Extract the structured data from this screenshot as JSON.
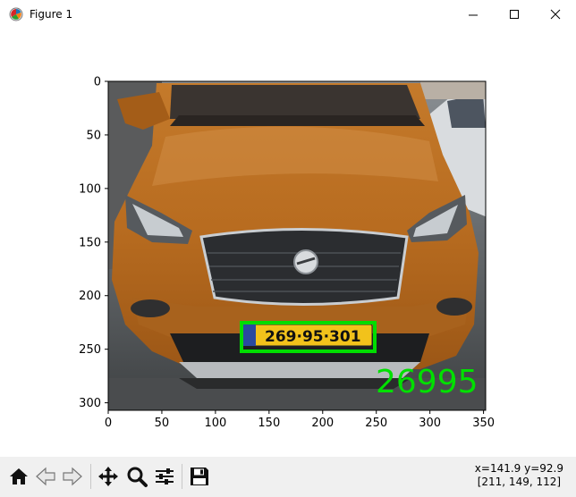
{
  "window": {
    "title": "Figure 1",
    "controls": [
      "minimize",
      "maximize",
      "close"
    ]
  },
  "plot": {
    "xticks": [
      "0",
      "50",
      "100",
      "150",
      "200",
      "250",
      "300",
      "350"
    ],
    "yticks": [
      "0",
      "50",
      "100",
      "150",
      "200",
      "250",
      "300"
    ],
    "xlim": [
      0,
      352
    ],
    "ylim": [
      0,
      307
    ],
    "image": {
      "description_type": "photo",
      "car_color": "#b5691f"
    },
    "detection_box": {
      "x1": 125,
      "y1": 225,
      "x2": 250,
      "y2": 253,
      "color": "#00dd00"
    },
    "plate_text": "269·95·301",
    "ocr_text": "26995",
    "ocr_text_color": "#00e000"
  },
  "toolbar": {
    "buttons": [
      "home",
      "back",
      "forward",
      "pan",
      "zoom",
      "configure-subplots",
      "save"
    ],
    "status_line1": "x=141.9 y=92.9",
    "status_line2": "[211, 149, 112]"
  }
}
